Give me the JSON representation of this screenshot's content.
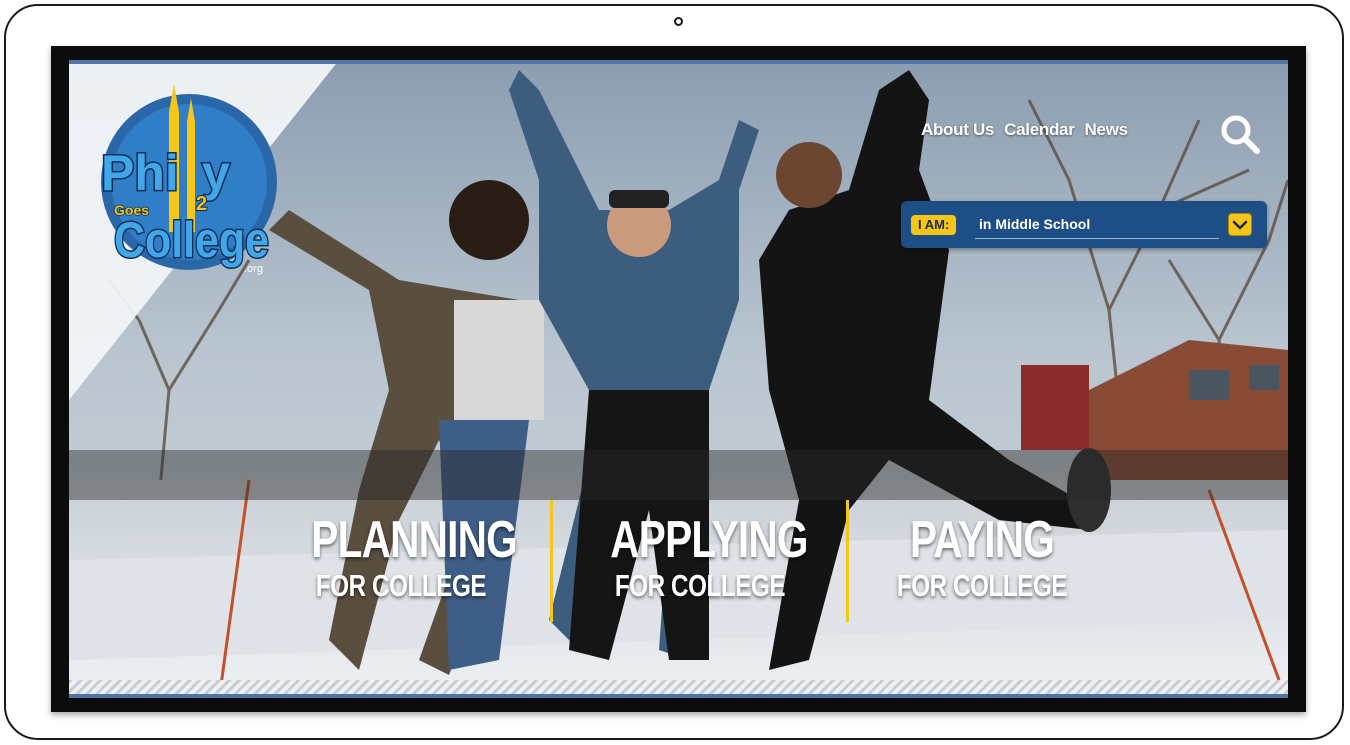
{
  "nav": {
    "links": [
      {
        "label": "About Us"
      },
      {
        "label": "Calendar"
      },
      {
        "label": "News"
      }
    ],
    "search_icon": "search-icon"
  },
  "logo": {
    "line1": "Philly",
    "goes": "Goes",
    "two": "2",
    "line2": "College",
    "tld": ".org"
  },
  "selector": {
    "prefix": "I AM:",
    "value": "in Middle School",
    "icon": "chevron-down-icon"
  },
  "ctas": [
    {
      "title": "PLANNING",
      "subtitle": "FOR COLLEGE"
    },
    {
      "title": "APPLYING",
      "subtitle": "FOR COLLEGE"
    },
    {
      "title": "PAYING",
      "subtitle": "FOR COLLEGE"
    }
  ],
  "colors": {
    "brand_blue": "#1d4f86",
    "accent_yellow": "#f5c518",
    "logo_blue": "#2f7ec7",
    "logo_yellow": "#f5c518"
  }
}
